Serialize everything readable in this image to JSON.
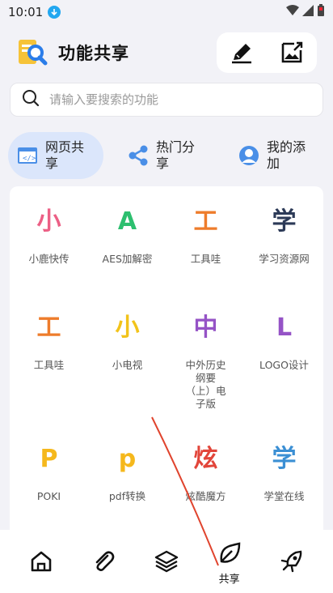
{
  "status_bar": {
    "time": "10:01",
    "download_icon": "download-icon"
  },
  "header": {
    "title": "功能共享",
    "edit_icon": "edit-pen-icon",
    "export_icon": "export-image-icon"
  },
  "search": {
    "placeholder": "请输入要搜索的功能"
  },
  "tabs": [
    {
      "label": "网页共享",
      "icon": "webpage-icon",
      "active": true
    },
    {
      "label": "热门分享",
      "icon": "share-icon",
      "active": false
    },
    {
      "label": "我的添加",
      "icon": "user-icon",
      "active": false
    }
  ],
  "grid": [
    [
      {
        "char": "小",
        "label": "小鹿快传",
        "color": "#ec5f85"
      },
      {
        "char": "A",
        "label": "AES加解密",
        "color": "#2dbf6f"
      },
      {
        "char": "工",
        "label": "工具哇",
        "color": "#ee7c2b"
      },
      {
        "char": "学",
        "label": "学习资源网",
        "color": "#2c3a57"
      }
    ],
    [
      {
        "char": "工",
        "label": "工具哇",
        "color": "#ee7c2b"
      },
      {
        "char": "小",
        "label": "小电视",
        "color": "#f2c31a"
      },
      {
        "char": "中",
        "label": "中外历史纲要（上）电子版",
        "color": "#9553c6"
      },
      {
        "char": "L",
        "label": "LOGO设计",
        "color": "#9553c6"
      }
    ],
    [
      {
        "char": "P",
        "label": "POKI",
        "color": "#f5b81c"
      },
      {
        "char": "p",
        "label": "pdf转换",
        "color": "#f5b81c"
      },
      {
        "char": "炫",
        "label": "炫酷魔方",
        "color": "#e2453a"
      },
      {
        "char": "学",
        "label": "学堂在线",
        "color": "#3b8fd4"
      }
    ]
  ],
  "bottom_nav": [
    {
      "icon": "home-icon",
      "label": ""
    },
    {
      "icon": "attachment-icon",
      "label": ""
    },
    {
      "icon": "layers-icon",
      "label": ""
    },
    {
      "icon": "leaf-share-icon",
      "label": "共享",
      "active": true
    },
    {
      "icon": "rocket-icon",
      "label": ""
    }
  ],
  "colors": {
    "accent_tab_bg": "#dbe6fb",
    "background": "#f2f2f7",
    "annotation_line": "#e0442e"
  }
}
